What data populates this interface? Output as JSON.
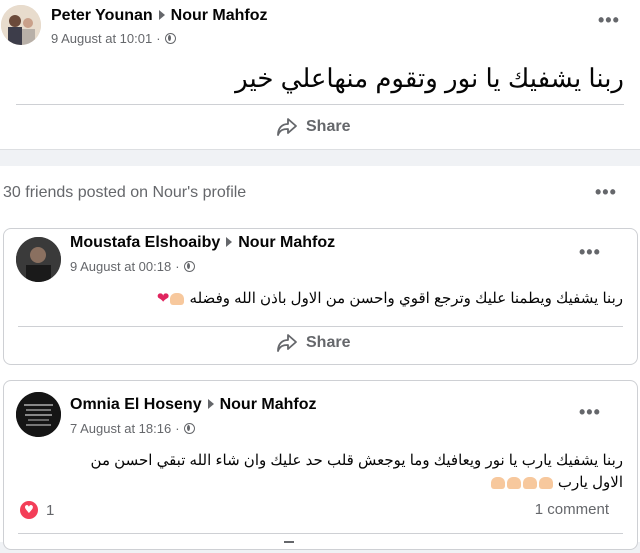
{
  "post": {
    "author": "Peter Younan",
    "target": "Nour Mahfoz",
    "timestamp": "9 August at 10:01",
    "text": "ربنا يشفيك يا نور وتقوم منهاعلي خير",
    "share_label": "Share"
  },
  "friends_section": {
    "title": "30 friends posted on Nour's profile"
  },
  "comments": [
    {
      "author": "Moustafa Elshoaiby",
      "target": "Nour Mahfoz",
      "timestamp": "9 August at 00:18",
      "text": "ربنا يشفيك ويطمنا عليك وترجع اقوي واحسن من الاول باذن الله  وفضله",
      "share_label": "Share"
    },
    {
      "author": "Omnia El Hoseny",
      "target": "Nour Mahfoz",
      "timestamp": "7 August at 18:16",
      "text_line1": "ربنا يشفيك يارب يا نور ويعافيك وما يوجعش قلب حد عليك وان شاء الله تبقي  احسن من",
      "text_line2": "الاول يارب",
      "reaction_count": "1",
      "comment_count": "1 comment",
      "avatar_text": "Dear Brother in Islam, Allah Protects you"
    }
  ],
  "colors": {
    "background": "#f0f2f5",
    "secondary_text": "#65676b",
    "love_reaction": "#f33e58"
  }
}
